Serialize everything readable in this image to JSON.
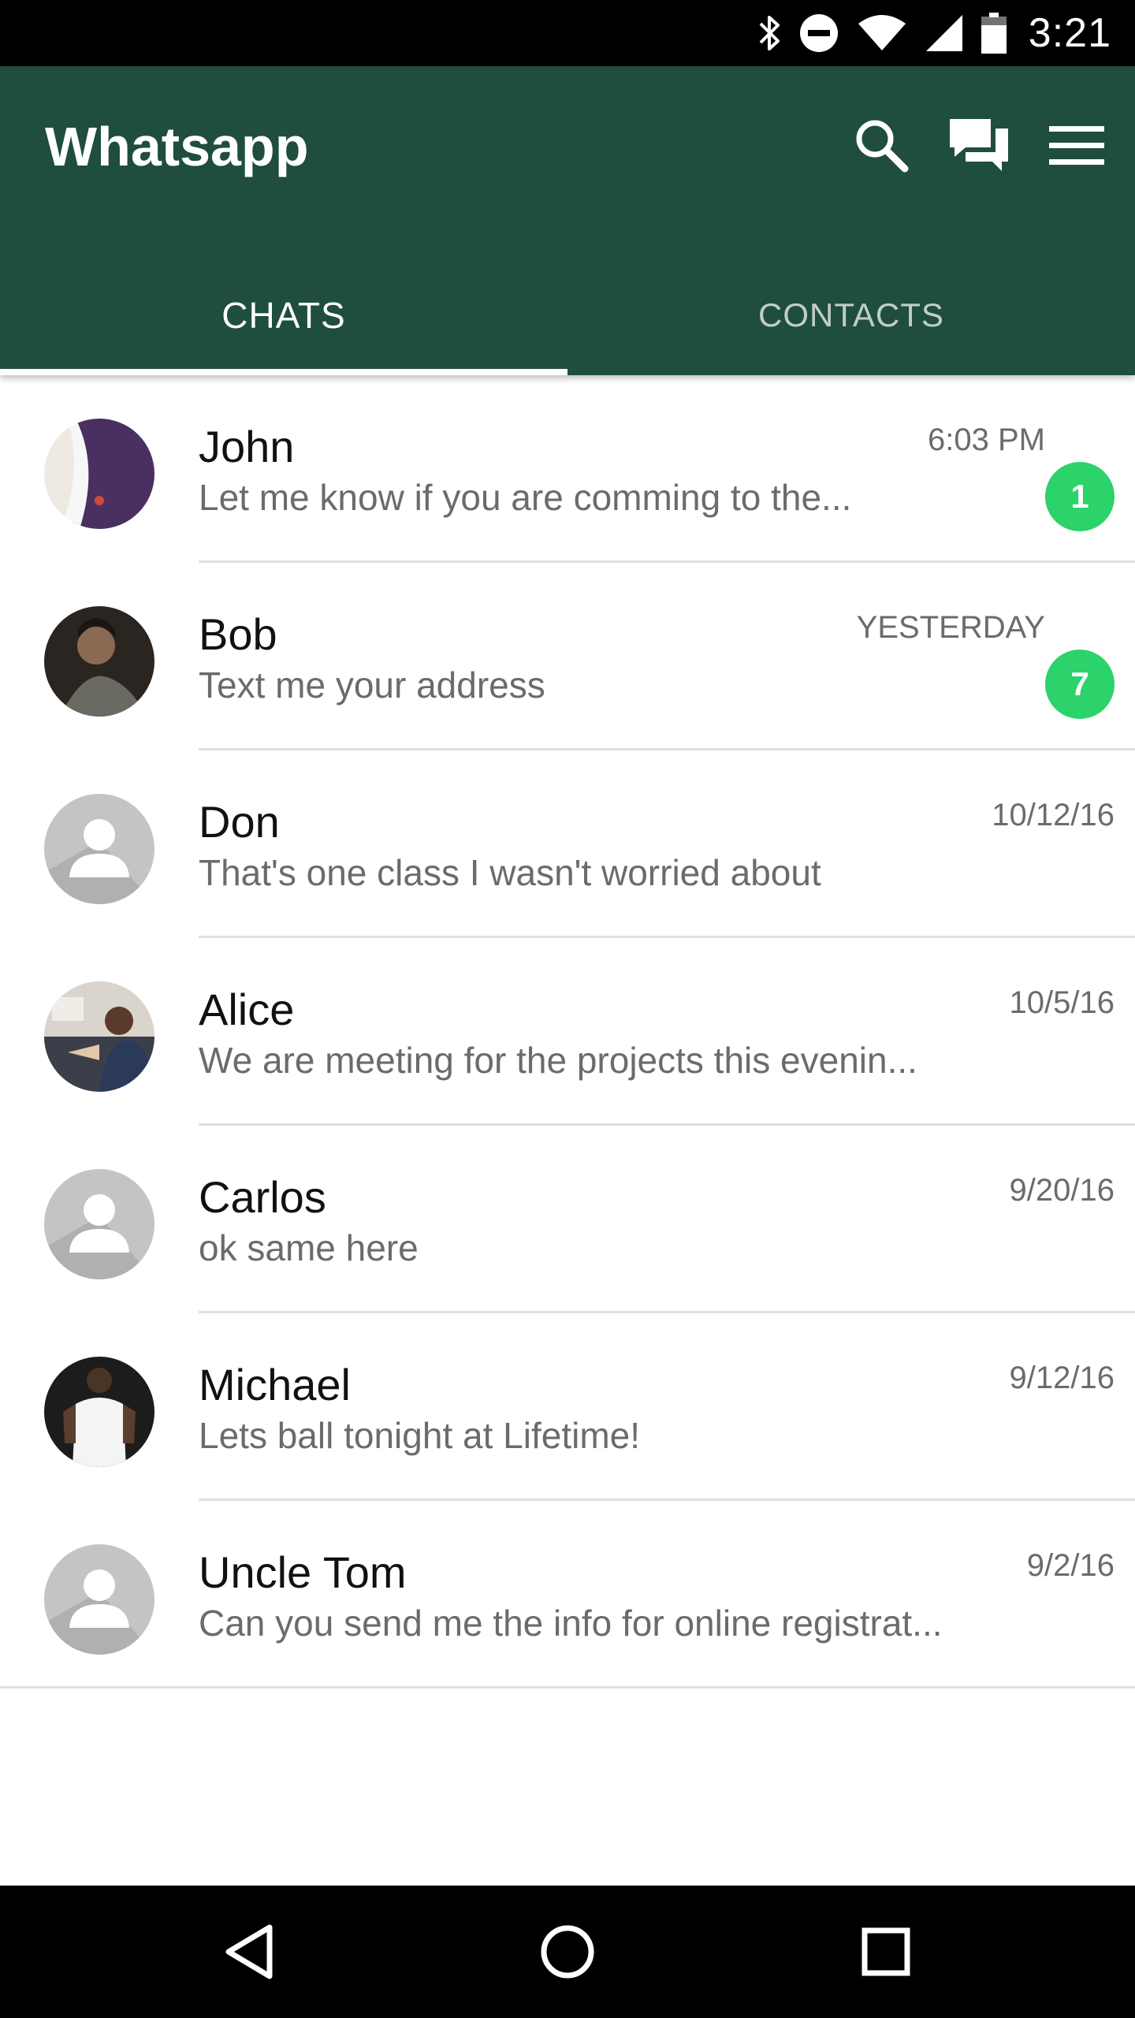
{
  "status_bar": {
    "time": "3:21",
    "icons": [
      "bluetooth-icon",
      "do-not-disturb-icon",
      "wifi-icon",
      "cellular-signal-icon",
      "battery-icon"
    ]
  },
  "app_bar": {
    "title": "Whatsapp",
    "actions": [
      "search-icon",
      "new-chat-icon",
      "menu-icon"
    ],
    "background": "#1f4d40"
  },
  "tabs": [
    {
      "label": "CHATS",
      "active": true
    },
    {
      "label": "CONTACTS",
      "active": false
    }
  ],
  "chats": [
    {
      "name": "John",
      "message": "Let me know if you are comming to the...",
      "time": "6:03 PM",
      "unread": "1",
      "avatar": "photo-suit"
    },
    {
      "name": "Bob",
      "message": "Text me your address",
      "time": "YESTERDAY",
      "unread": "7",
      "avatar": "photo-dark"
    },
    {
      "name": "Don",
      "message": "That's one class I wasn't worried about",
      "time": "10/12/16",
      "avatar": "default-person-icon"
    },
    {
      "name": "Alice",
      "message": "We are meeting for the projects this evenin...",
      "time": "10/5/16",
      "avatar": "photo-meeting"
    },
    {
      "name": "Carlos",
      "message": "ok same here",
      "time": "9/20/16",
      "avatar": "default-person-icon"
    },
    {
      "name": "Michael",
      "message": "Lets ball tonight at Lifetime!",
      "time": "9/12/16",
      "avatar": "photo-basketball"
    },
    {
      "name": "Uncle Tom",
      "message": "Can you send me the info for online registrat...",
      "time": "9/2/16",
      "avatar": "default-person-icon"
    }
  ],
  "colors": {
    "badge": "#2bd36a",
    "divider": "#e0e0e0",
    "secondary_text": "#6b6b6b"
  },
  "nav_bar": [
    "back-icon",
    "home-icon",
    "recents-icon"
  ]
}
